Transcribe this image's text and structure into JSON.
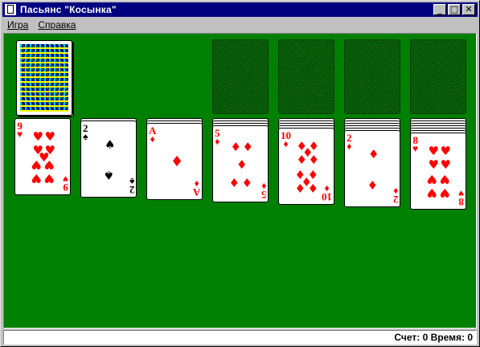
{
  "window": {
    "title": "Пасьянс \"Косынка\""
  },
  "titlebar_buttons": {
    "minimize": "_",
    "maximize": "□",
    "close": "✕"
  },
  "menu": [
    {
      "label": "Игра"
    },
    {
      "label": "Справка"
    }
  ],
  "status": {
    "text": "Счет: 0 Время: 0",
    "score": 0,
    "time": 0
  },
  "colors": {
    "felt": "#008000",
    "title_bar": "#000080",
    "red": "#ff0000",
    "black": "#000000"
  },
  "game": {
    "stock": {
      "face_down": true
    },
    "foundations": [
      {
        "empty": true
      },
      {
        "empty": true
      },
      {
        "empty": true
      },
      {
        "empty": true
      }
    ],
    "tableau": [
      {
        "face_down_count": 0,
        "top": {
          "rank": "9",
          "suit": "♥",
          "color": "red"
        }
      },
      {
        "face_down_count": 1,
        "top": {
          "rank": "2",
          "suit": "♠",
          "color": "black"
        }
      },
      {
        "face_down_count": 2,
        "top": {
          "rank": "A",
          "suit": "♦",
          "color": "red"
        }
      },
      {
        "face_down_count": 3,
        "top": {
          "rank": "5",
          "suit": "♦",
          "color": "red"
        }
      },
      {
        "face_down_count": 4,
        "top": {
          "rank": "10",
          "suit": "♦",
          "color": "red"
        }
      },
      {
        "face_down_count": 5,
        "top": {
          "rank": "2",
          "suit": "♦",
          "color": "red"
        }
      },
      {
        "face_down_count": 6,
        "top": {
          "rank": "8",
          "suit": "♥",
          "color": "red"
        }
      }
    ]
  }
}
